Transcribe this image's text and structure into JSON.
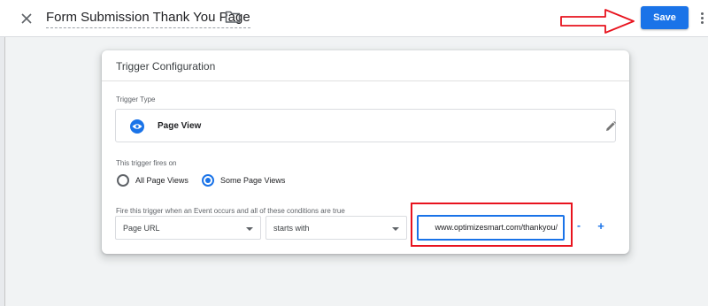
{
  "header": {
    "title": "Form Submission Thank You Page",
    "save_label": "Save",
    "close_icon": "close-icon",
    "folder_icon": "folder-icon",
    "more_icon": "more-vert-icon"
  },
  "card": {
    "title": "Trigger Configuration",
    "trigger_type_label": "Trigger Type",
    "trigger_type": "Page View",
    "trigger_icon": "eye-icon",
    "fires_on_label": "This trigger fires on",
    "options": [
      "All Page Views",
      "Some Page Views"
    ],
    "selected_option": "Some Page Views",
    "condition_label": "Fire this trigger when an Event occurs and all of these conditions are true",
    "condition": {
      "variable": "Page URL",
      "operator": "starts with",
      "value": "www.optimizesmart.com/thankyou/"
    },
    "remove_label": "-",
    "add_label": "+"
  },
  "colors": {
    "accent": "#1a73e8",
    "annotation": "#e8131e"
  }
}
